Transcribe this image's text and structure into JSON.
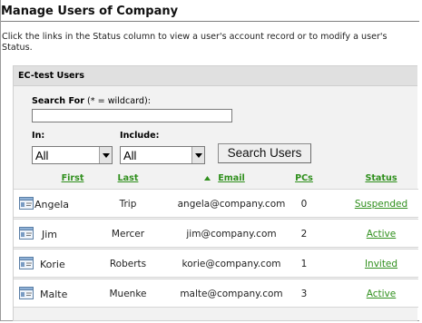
{
  "page": {
    "title": "Manage Users of Company",
    "intro": "Click the links in the Status column to view a user's account record or to modify a user's Status."
  },
  "panel": {
    "title": "EC-test Users",
    "search_label_bold": "Search For",
    "search_label_hint": " (* = wildcard):",
    "search_value": "",
    "in_label": "In:",
    "include_label": "Include:",
    "in_value": "All",
    "include_value": "All",
    "search_button": "Search Users"
  },
  "table": {
    "columns": [
      "First",
      "Last",
      "Email",
      "PCs",
      "Status"
    ],
    "sorted_column": "Email",
    "rows": [
      {
        "first": "Angela",
        "last": "Trip",
        "email": "angela@company.com",
        "pcs": "0",
        "status": "Suspended"
      },
      {
        "first": "Jim",
        "last": "Mercer",
        "email": "jim@company.com",
        "pcs": "2",
        "status": "Active"
      },
      {
        "first": "Korie",
        "last": "Roberts",
        "email": "korie@company.com",
        "pcs": "1",
        "status": "Invited"
      },
      {
        "first": "Malte",
        "last": "Muenke",
        "email": "malte@company.com",
        "pcs": "3",
        "status": "Active"
      }
    ]
  },
  "colors": {
    "link_green": "#2f8f1c",
    "panel_bg": "#f2f2f2",
    "header_bg": "#e0e0e0"
  },
  "icons": {
    "row_icon": "user-card-icon",
    "sort_icon": "sort-ascending-icon",
    "dropdown_icon": "chevron-down-icon"
  }
}
